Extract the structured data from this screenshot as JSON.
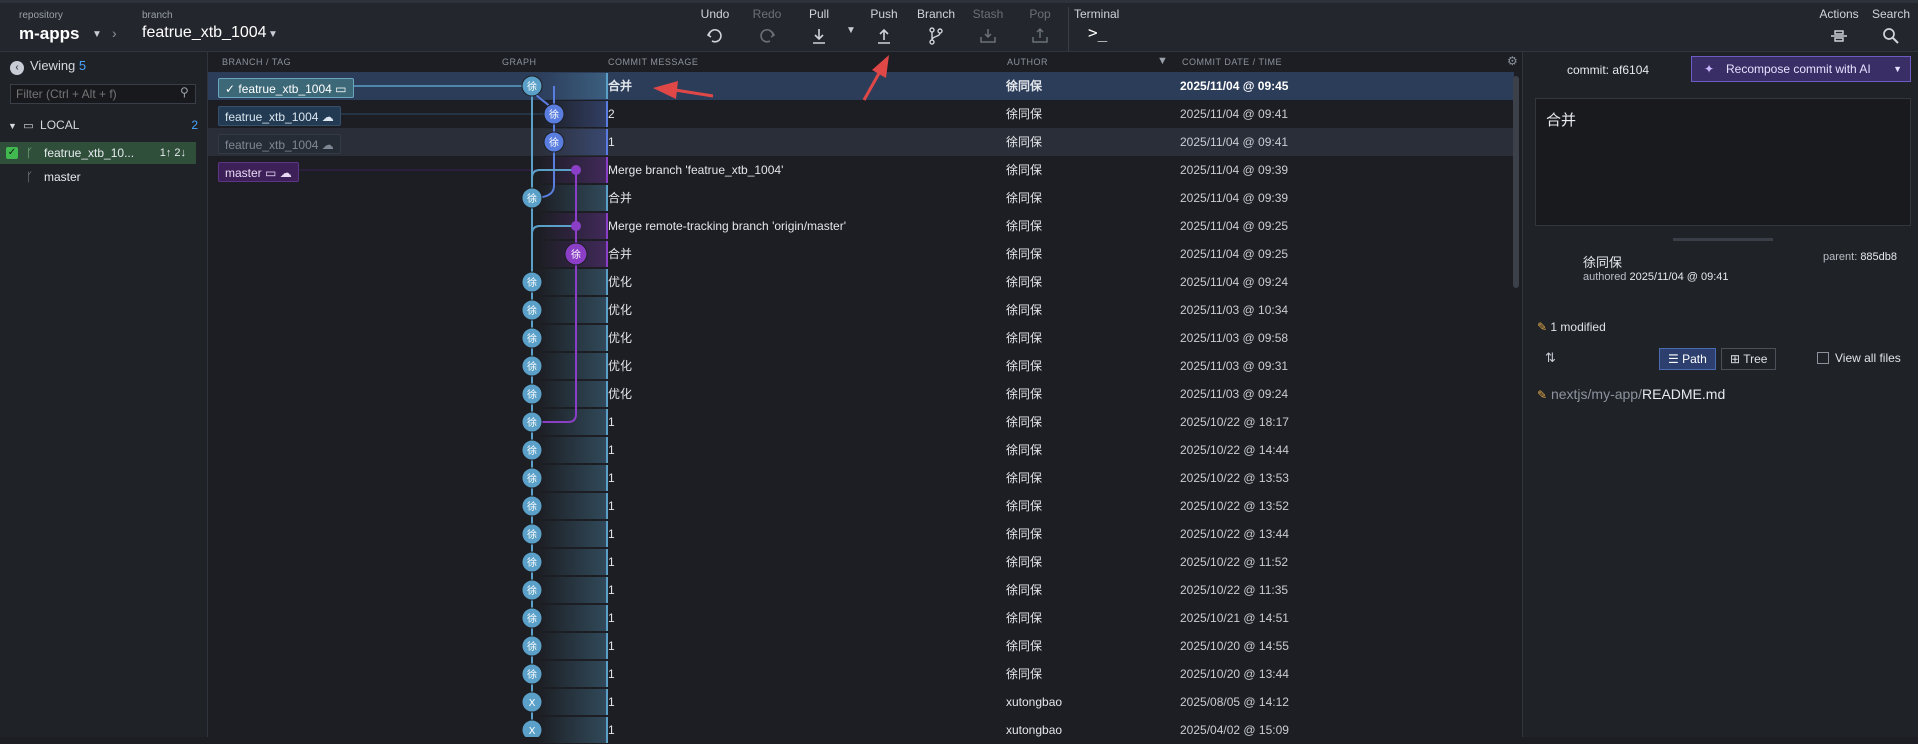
{
  "toolbar": {
    "repo_label": "repository",
    "repo_name": "m-apps",
    "branch_label": "branch",
    "branch_name": "featrue_xtb_1004",
    "buttons": [
      {
        "label": "Undo",
        "icon": "undo-icon",
        "enabled": true
      },
      {
        "label": "Redo",
        "icon": "redo-icon",
        "enabled": false
      },
      {
        "label": "Pull",
        "icon": "pull-icon",
        "enabled": true
      },
      {
        "label": "Push",
        "icon": "push-icon",
        "enabled": true
      },
      {
        "label": "Branch",
        "icon": "branch-icon",
        "enabled": true
      },
      {
        "label": "Stash",
        "icon": "stash-icon",
        "enabled": false
      },
      {
        "label": "Pop",
        "icon": "pop-icon",
        "enabled": false
      }
    ],
    "terminal_label": "Terminal",
    "actions_label": "Actions",
    "search_label": "Search"
  },
  "left": {
    "viewing_label": "Viewing",
    "viewing_count": "5",
    "filter_placeholder": "Filter (Ctrl + Alt + f)",
    "local_label": "LOCAL",
    "local_count": "2",
    "branches": [
      {
        "name": "featrue_xtb_10...",
        "ahead_behind": "1↑ 2↓",
        "selected": true
      },
      {
        "name": "master",
        "ahead_behind": "",
        "selected": false
      }
    ]
  },
  "columns": {
    "branch_tag": "BRANCH / TAG",
    "graph": "GRAPH",
    "message": "COMMIT MESSAGE",
    "author": "AUTHOR",
    "date": "COMMIT DATE / TIME"
  },
  "tags": [
    {
      "name": "featrue_xtb_1004",
      "style": "current"
    },
    {
      "name": "featrue_xtb_1004",
      "style": "remote"
    },
    {
      "name": "featrue_xtb_1004",
      "style": "remote-faded"
    },
    {
      "name": "master",
      "style": "master"
    }
  ],
  "commits": [
    {
      "message": "合并",
      "author": "徐同保",
      "date": "2025/11/04 @ 09:45",
      "avatar": "徐"
    },
    {
      "message": "2",
      "author": "徐同保",
      "date": "2025/11/04 @ 09:41",
      "avatar": "徐"
    },
    {
      "message": "1",
      "author": "徐同保",
      "date": "2025/11/04 @ 09:41",
      "avatar": "徐"
    },
    {
      "message": "Merge branch 'featrue_xtb_1004'",
      "author": "徐同保",
      "date": "2025/11/04 @ 09:39",
      "avatar": ""
    },
    {
      "message": "合并",
      "author": "徐同保",
      "date": "2025/11/04 @ 09:39",
      "avatar": "徐"
    },
    {
      "message": "Merge remote-tracking branch 'origin/master'",
      "author": "徐同保",
      "date": "2025/11/04 @ 09:25",
      "avatar": ""
    },
    {
      "message": "合并",
      "author": "徐同保",
      "date": "2025/11/04 @ 09:25",
      "avatar": "徐"
    },
    {
      "message": "优化",
      "author": "徐同保",
      "date": "2025/11/04 @ 09:24",
      "avatar": "徐"
    },
    {
      "message": "优化",
      "author": "徐同保",
      "date": "2025/11/03 @ 10:34",
      "avatar": "徐"
    },
    {
      "message": "优化",
      "author": "徐同保",
      "date": "2025/11/03 @ 09:58",
      "avatar": "徐"
    },
    {
      "message": "优化",
      "author": "徐同保",
      "date": "2025/11/03 @ 09:31",
      "avatar": "徐"
    },
    {
      "message": "优化",
      "author": "徐同保",
      "date": "2025/11/03 @ 09:24",
      "avatar": "徐"
    },
    {
      "message": "1",
      "author": "徐同保",
      "date": "2025/10/22 @ 18:17",
      "avatar": "徐"
    },
    {
      "message": "1",
      "author": "徐同保",
      "date": "2025/10/22 @ 14:44",
      "avatar": "徐"
    },
    {
      "message": "1",
      "author": "徐同保",
      "date": "2025/10/22 @ 13:53",
      "avatar": "徐"
    },
    {
      "message": "1",
      "author": "徐同保",
      "date": "2025/10/22 @ 13:52",
      "avatar": "徐"
    },
    {
      "message": "1",
      "author": "徐同保",
      "date": "2025/10/22 @ 13:44",
      "avatar": "徐"
    },
    {
      "message": "1",
      "author": "徐同保",
      "date": "2025/10/22 @ 11:52",
      "avatar": "徐"
    },
    {
      "message": "1",
      "author": "徐同保",
      "date": "2025/10/22 @ 11:35",
      "avatar": "徐"
    },
    {
      "message": "1",
      "author": "徐同保",
      "date": "2025/10/21 @ 14:51",
      "avatar": "徐"
    },
    {
      "message": "1",
      "author": "徐同保",
      "date": "2025/10/20 @ 14:55",
      "avatar": "徐"
    },
    {
      "message": "1",
      "author": "徐同保",
      "date": "2025/10/20 @ 13:44",
      "avatar": "徐"
    },
    {
      "message": "1",
      "author": "xutongbao",
      "date": "2025/08/05 @ 14:12",
      "avatar": "X"
    },
    {
      "message": "1",
      "author": "xutongbao",
      "date": "2025/04/02 @ 15:09",
      "avatar": "X"
    }
  ],
  "detail": {
    "commit_label": "commit:",
    "commit_sha": "af6104",
    "recompose_label": "Recompose commit with AI",
    "message": "合并",
    "author": "徐同保",
    "authored_label": "authored",
    "authored_date": "2025/11/04 @ 09:41",
    "parent_label": "parent:",
    "parent_sha": "885db8",
    "modified_summary": "1 modified",
    "path_label": "Path",
    "tree_label": "Tree",
    "view_all_label": "View all files",
    "file_dir": "nextjs/my-app/",
    "file_name": "README.md"
  },
  "colors": {
    "lane_blue": "#5ba0c8",
    "lane_indigo": "#5a7de0",
    "lane_purple": "#8a3fc6",
    "selection": "#2c3d5a",
    "accent": "#4aa3ff"
  }
}
